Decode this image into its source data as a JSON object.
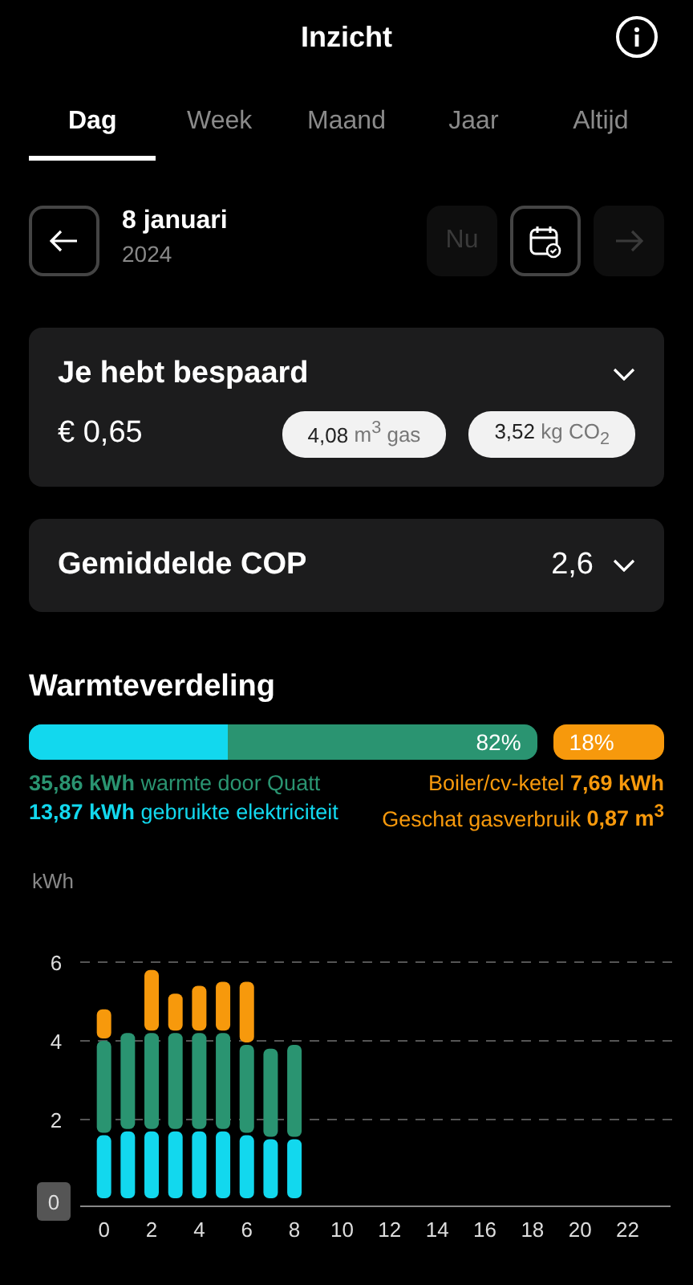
{
  "header": {
    "title": "Inzicht"
  },
  "tabs": [
    {
      "label": "Dag",
      "selected": true
    },
    {
      "label": "Week",
      "selected": false
    },
    {
      "label": "Maand",
      "selected": false
    },
    {
      "label": "Jaar",
      "selected": false
    },
    {
      "label": "Altijd",
      "selected": false
    }
  ],
  "date_nav": {
    "date": "8 januari",
    "year": "2024",
    "now_button": {
      "label": "Nu",
      "disabled": true
    },
    "next_disabled": true
  },
  "savings_card": {
    "title": "Je hebt bespaard",
    "amount": "€ 0,65",
    "chips": [
      {
        "value": "4,08",
        "unit": "m$^{3}$ gas"
      },
      {
        "value": "3,52",
        "unit": "kg CO$_{2}$"
      }
    ]
  },
  "cop_card": {
    "title": "Gemiddelde COP",
    "value": "2,6"
  },
  "heat_distribution": {
    "title": "Warmteverdeling",
    "quatt_bar": {
      "label": "82%"
    },
    "electricity_fill": {
      "level": 0.39
    },
    "boiler_label": "18%",
    "legend_left": [
      {
        "text": "**35,86 kWh** warmte door Quatt",
        "color": "#2a9471"
      },
      {
        "text": "**13,87 kWh** gebruikte elektriciteit",
        "color": "#12d8ee"
      }
    ],
    "legend_right": [
      {
        "text": "Boiler/cv-ketel **7,69 kWh**",
        "color": "#f7990c"
      },
      {
        "text": "Geschat gasverbruik **0,87 m$^{3}$**",
        "color": "#f7990c"
      }
    ]
  },
  "chart": {
    "ylabel": "kWh",
    "chart_data": {
      "type": "bar",
      "stacked": true,
      "x": [
        0,
        1,
        2,
        3,
        4,
        5,
        6,
        7,
        8
      ],
      "series": [
        {
          "color": "#12d8ee",
          "values": [
            1.6,
            1.7,
            1.7,
            1.7,
            1.7,
            1.7,
            1.6,
            1.5,
            1.5
          ]
        },
        {
          "color": "#2a9471",
          "values": [
            2.4,
            2.5,
            2.5,
            2.5,
            2.5,
            2.5,
            2.3,
            2.3,
            2.4
          ]
        },
        {
          "color": "#f7990c",
          "values": [
            0.8,
            0,
            1.6,
            1.0,
            1.2,
            1.3,
            1.6,
            0,
            0
          ]
        }
      ],
      "xlim": [
        -1,
        23.8
      ],
      "ylim": [
        0,
        6
      ],
      "yticks": [
        0,
        2,
        4,
        6
      ],
      "xticks": [
        0,
        2,
        4,
        6,
        8,
        10,
        12,
        14,
        16,
        18,
        20,
        22
      ]
    }
  }
}
